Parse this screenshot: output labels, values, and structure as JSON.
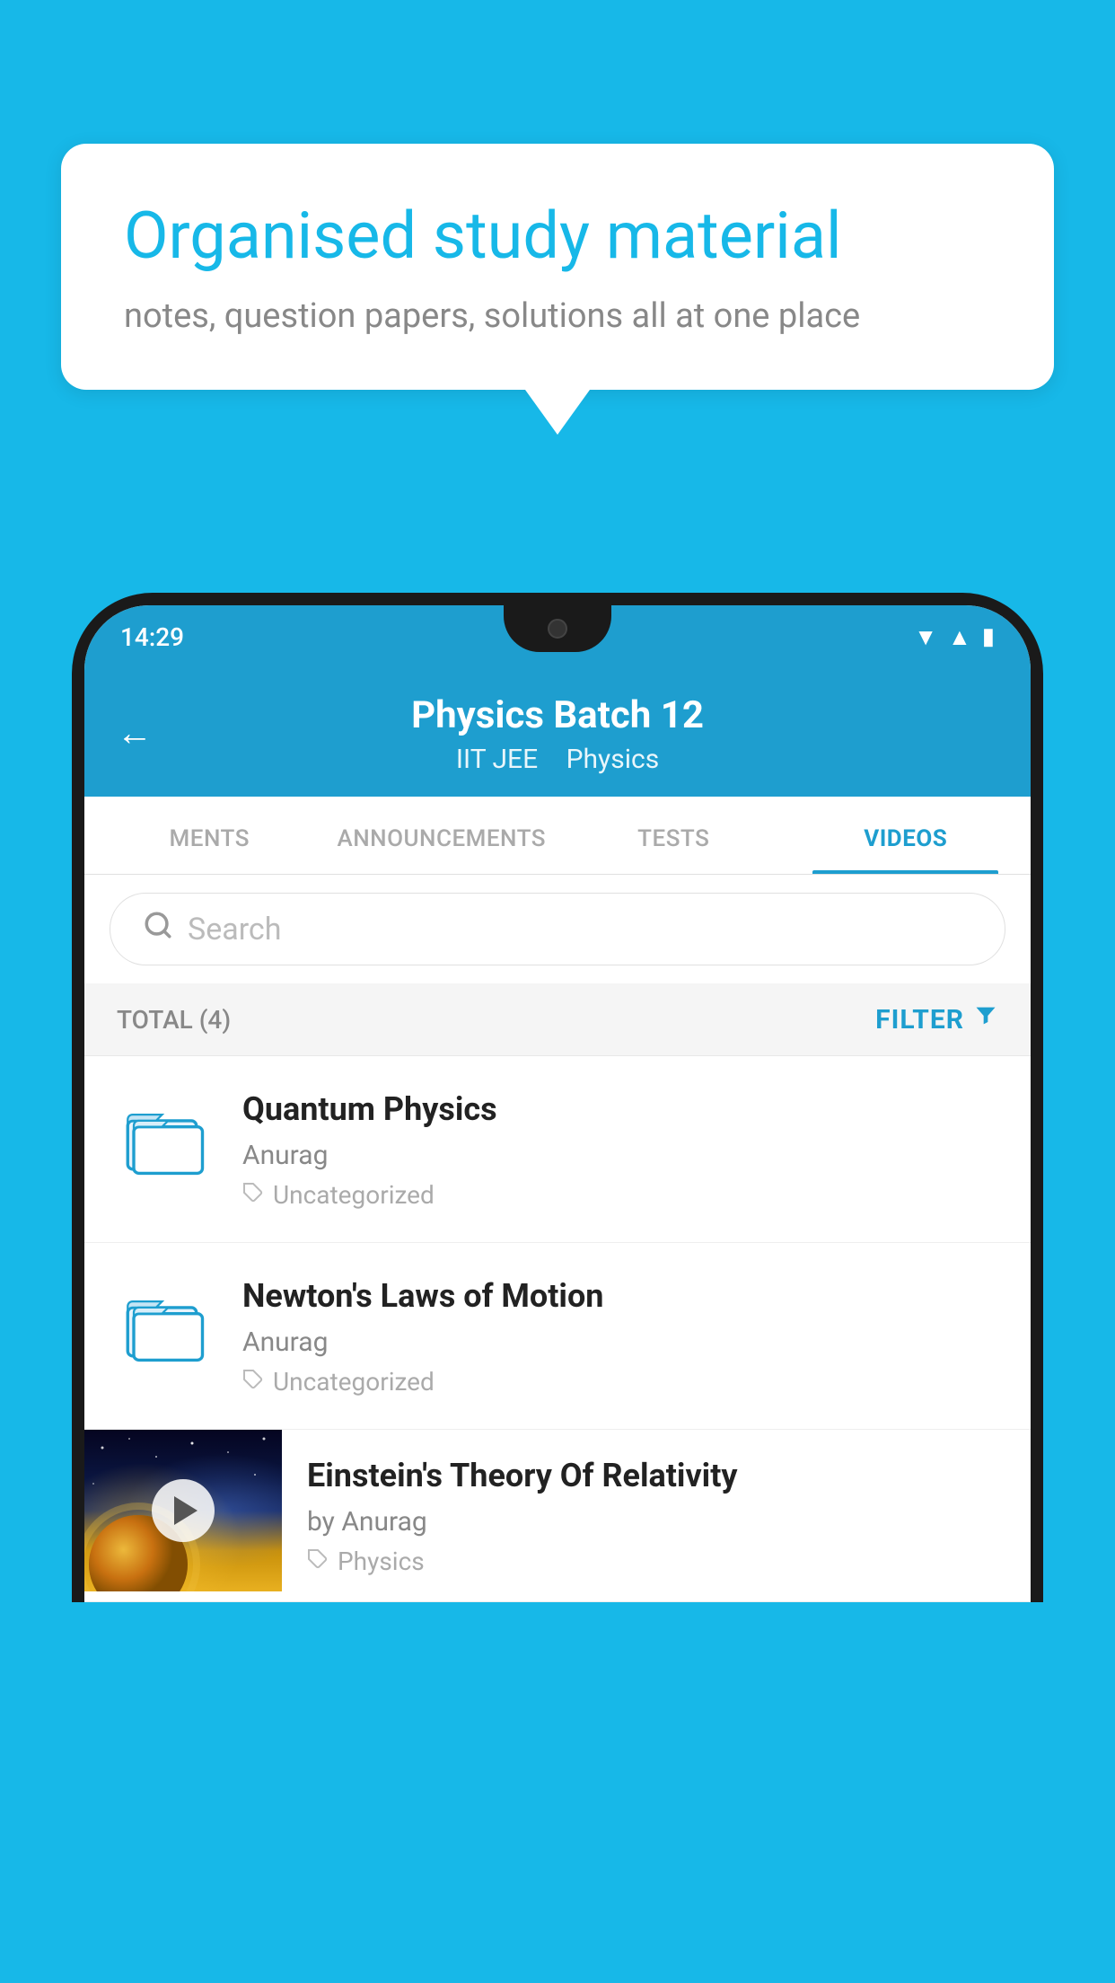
{
  "background_color": "#17b8e8",
  "speech_bubble": {
    "title": "Organised study material",
    "subtitle": "notes, question papers, solutions all at one place"
  },
  "phone": {
    "status_bar": {
      "time": "14:29",
      "wifi": "▾",
      "signal": "▴",
      "battery": "▮"
    },
    "header": {
      "title": "Physics Batch 12",
      "tags": [
        "IIT JEE",
        "Physics"
      ],
      "back_label": "←"
    },
    "tabs": [
      {
        "label": "MENTS",
        "active": false
      },
      {
        "label": "ANNOUNCEMENTS",
        "active": false
      },
      {
        "label": "TESTS",
        "active": false
      },
      {
        "label": "VIDEOS",
        "active": true
      }
    ],
    "search": {
      "placeholder": "Search"
    },
    "filter_row": {
      "total_label": "TOTAL (4)",
      "filter_label": "FILTER"
    },
    "videos": [
      {
        "title": "Quantum Physics",
        "author": "Anurag",
        "tag": "Uncategorized",
        "has_thumbnail": false
      },
      {
        "title": "Newton's Laws of Motion",
        "author": "Anurag",
        "tag": "Uncategorized",
        "has_thumbnail": false
      },
      {
        "title": "Einstein's Theory Of Relativity",
        "author": "by Anurag",
        "tag": "Physics",
        "has_thumbnail": true
      }
    ]
  }
}
